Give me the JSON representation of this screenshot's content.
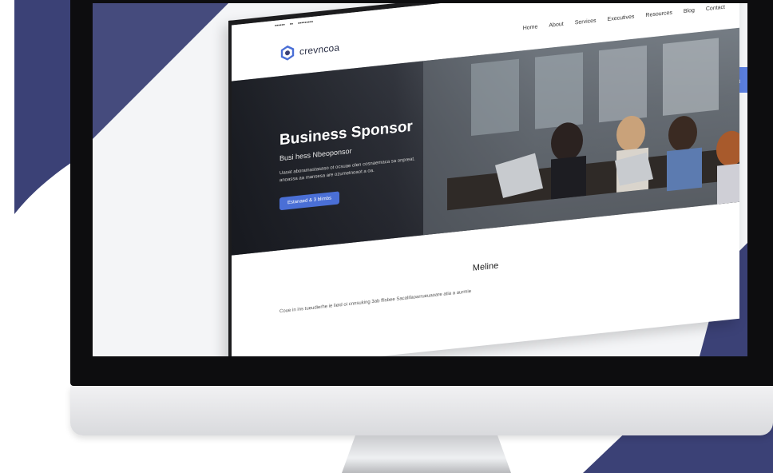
{
  "colors": {
    "accent_navy": "#3b4176",
    "accent_blue": "#4a6fd6",
    "bezel": "#0d0d0f"
  },
  "site": {
    "topstrip": [
      "▪▪▪▪▪▪",
      "▪▪",
      "▪▪▪▪▪▪▪▪▪"
    ],
    "logo_text": "crevncoa",
    "nav": [
      "Home",
      "About",
      "Services",
      "Executives",
      "Resources",
      "Blog",
      "Contact"
    ],
    "hero": {
      "title": "Business Sponsor",
      "subtitle": "Busi hess Nbeoponsor",
      "description": "Uasat aboramastasaso ot ocsuae olen cosnaemaca sa onpreat. anoassa aa mansesa are ozumetnoaot a oa.",
      "button_label": "Estanaed & 3 blimbs"
    },
    "section": {
      "title": "Meline",
      "text": "Coue in ins tueudierhe ie lieid oi cnnsuking 3ab ffisbee Sacalifaoarrueuaoare atia a aurmie"
    }
  },
  "side_button_icon": "home-icon",
  "side_refresh_icon": "refresh-icon"
}
